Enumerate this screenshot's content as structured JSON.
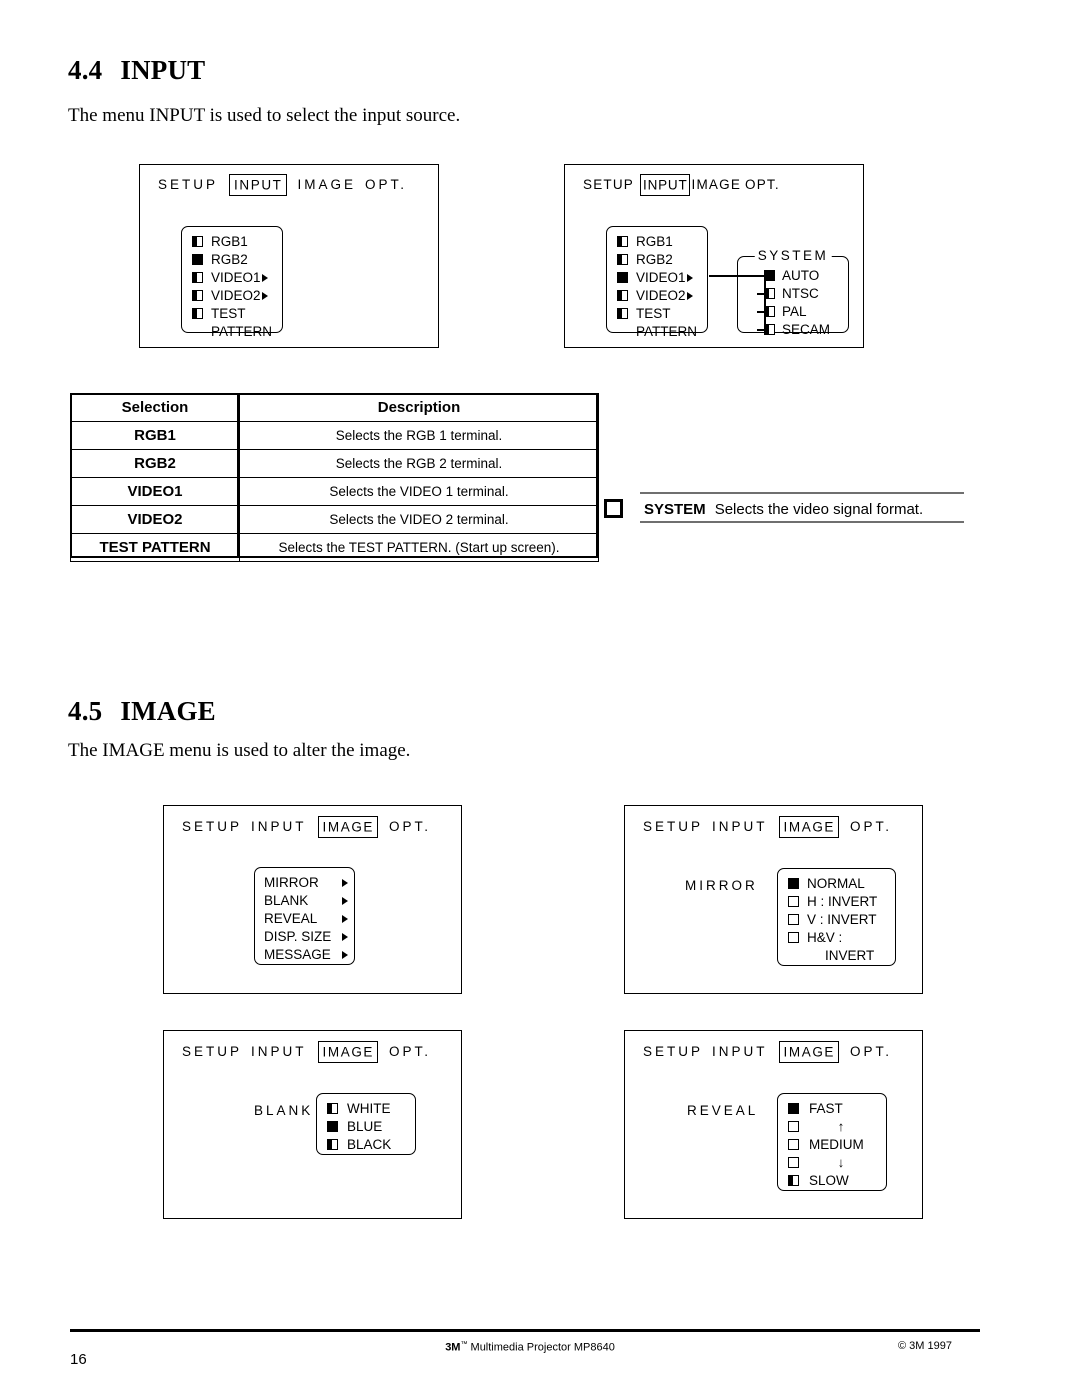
{
  "page": {
    "number": "16",
    "footer_center_brand": "3M",
    "footer_center_tm": "™",
    "footer_center_rest": " Multimedia Projector MP8640",
    "footer_right": "© 3M 1997"
  },
  "section_input": {
    "number": "4.4",
    "title": "INPUT",
    "intro": "The menu INPUT is used to select the input source."
  },
  "section_image": {
    "number": "4.5",
    "title": "IMAGE",
    "intro": "The IMAGE menu is used to alter the image."
  },
  "osd_tabs": {
    "setup": "SETUP",
    "input": "INPUT",
    "image": "IMAGE",
    "opt": "OPT."
  },
  "osd_input_1": {
    "selected_tab": "INPUT",
    "items": [
      {
        "label": "RGB1",
        "checked": false,
        "arrow": false
      },
      {
        "label": "RGB2",
        "checked": true,
        "arrow": false
      },
      {
        "label": "VIDEO1",
        "checked": false,
        "arrow": true
      },
      {
        "label": "VIDEO2",
        "checked": false,
        "arrow": true
      },
      {
        "label": "TEST",
        "checked": false,
        "arrow": false
      },
      {
        "label": "PATTERN",
        "checked": null,
        "arrow": false
      }
    ]
  },
  "osd_input_2": {
    "selected_tab": "INPUT",
    "items": [
      {
        "label": "RGB1",
        "checked": false,
        "arrow": false
      },
      {
        "label": "RGB2",
        "checked": false,
        "arrow": false
      },
      {
        "label": "VIDEO1",
        "checked": true,
        "arrow": true
      },
      {
        "label": "VIDEO2",
        "checked": false,
        "arrow": true
      },
      {
        "label": "TEST",
        "checked": false,
        "arrow": false
      },
      {
        "label": "PATTERN",
        "checked": null,
        "arrow": false
      }
    ],
    "system": {
      "legend": "SYSTEM",
      "items": [
        {
          "label": "AUTO",
          "checked": true
        },
        {
          "label": "NTSC",
          "checked": false
        },
        {
          "label": "PAL",
          "checked": false
        },
        {
          "label": "SECAM",
          "checked": false
        }
      ]
    }
  },
  "input_table": {
    "headers": [
      "Selection",
      "Description"
    ],
    "rows": [
      {
        "selection": "RGB1",
        "description": "Selects the RGB 1 terminal."
      },
      {
        "selection": "RGB2",
        "description": "Selects the RGB 2 terminal."
      },
      {
        "selection": "VIDEO1",
        "description": "Selects the VIDEO 1 terminal."
      },
      {
        "selection": "VIDEO2",
        "description": "Selects the VIDEO 2 terminal."
      },
      {
        "selection": "TEST PATTERN",
        "description": "Selects the TEST PATTERN. (Start up screen)."
      }
    ]
  },
  "system_note": {
    "term": "SYSTEM",
    "description": "Selects the video signal format."
  },
  "osd_image_menu": {
    "selected_tab": "IMAGE",
    "items": [
      {
        "label": "MIRROR",
        "arrow": true
      },
      {
        "label": "BLANK",
        "arrow": true
      },
      {
        "label": "REVEAL",
        "arrow": true
      },
      {
        "label": "DISP. SIZE",
        "arrow": true
      },
      {
        "label": "MESSAGE",
        "arrow": true
      }
    ]
  },
  "osd_image_mirror": {
    "selected_tab": "IMAGE",
    "side_label": "MIRROR",
    "items": [
      {
        "label": "NORMAL",
        "checked": true
      },
      {
        "label": "H : INVERT",
        "checked": false
      },
      {
        "label": "V : INVERT",
        "checked": false
      },
      {
        "label": "H&V :",
        "checked": false
      },
      {
        "label": "INVERT",
        "checked": null
      }
    ]
  },
  "osd_image_blank": {
    "selected_tab": "IMAGE",
    "side_label": "BLANK",
    "items": [
      {
        "label": "WHITE",
        "checked": false
      },
      {
        "label": "BLUE",
        "checked": true
      },
      {
        "label": "BLACK",
        "checked": false
      }
    ]
  },
  "osd_image_reveal": {
    "selected_tab": "IMAGE",
    "side_label": "REVEAL",
    "items": [
      {
        "label": "FAST",
        "checked": true
      },
      {
        "label": "↑",
        "checked": false
      },
      {
        "label": "MEDIUM",
        "checked": false
      },
      {
        "label": "↓",
        "checked": false
      },
      {
        "label": "SLOW",
        "checked": false
      }
    ]
  }
}
